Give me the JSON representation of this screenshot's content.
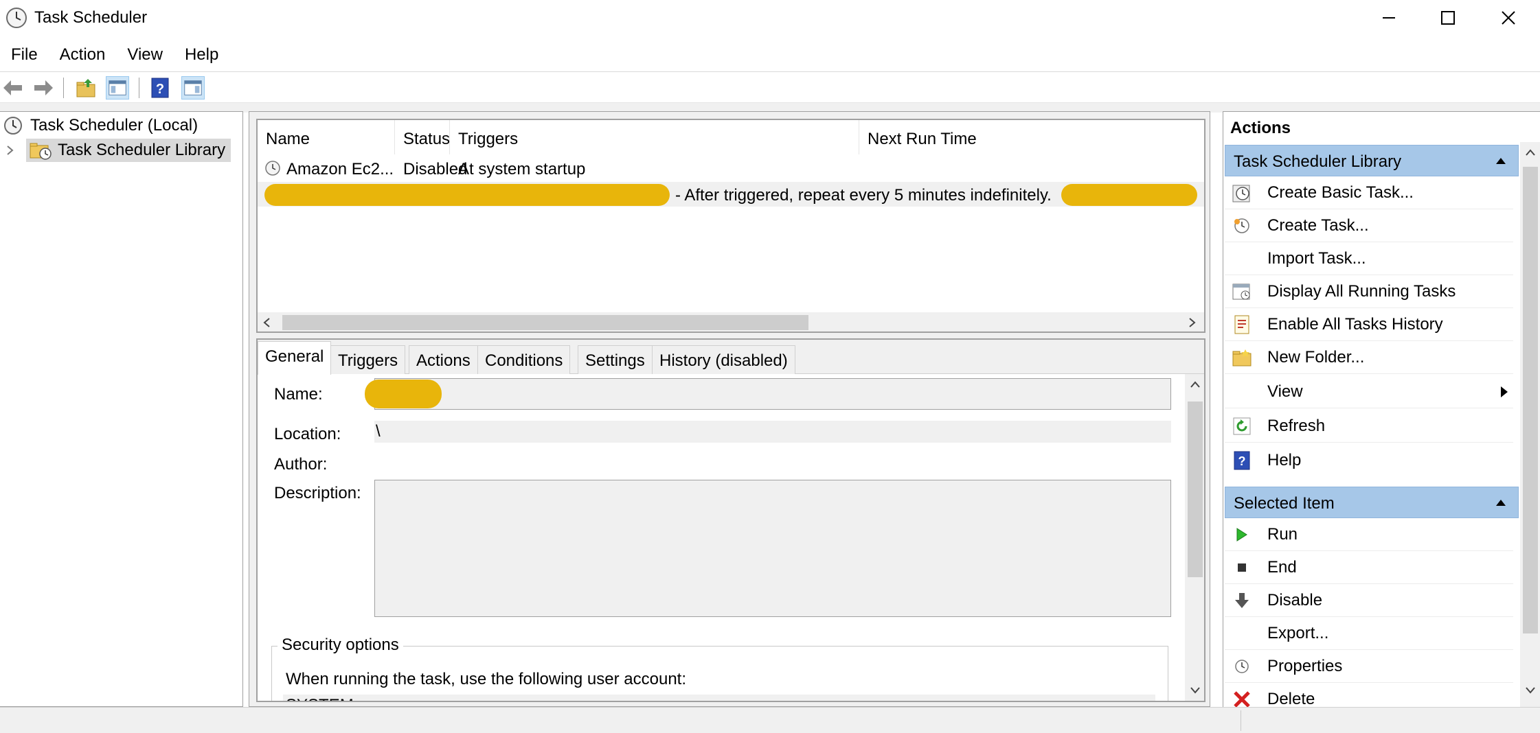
{
  "window": {
    "title": "Task Scheduler"
  },
  "menu": {
    "items": [
      "File",
      "Action",
      "View",
      "Help"
    ]
  },
  "tree": {
    "root": "Task Scheduler (Local)",
    "library": "Task Scheduler Library"
  },
  "tasklist": {
    "columns": [
      "Name",
      "Status",
      "Triggers",
      "Next Run Time"
    ],
    "rows": [
      {
        "name": "Amazon Ec2...",
        "status": "Disabled",
        "triggers": "At system startup"
      },
      {
        "name": "",
        "status": "",
        "triggers": "- After triggered, repeat every 5 minutes indefinitely."
      }
    ]
  },
  "detail": {
    "tabs": [
      "General",
      "Triggers",
      "Actions",
      "Conditions",
      "Settings",
      "History (disabled)"
    ],
    "active_tab": "General",
    "labels": {
      "name": "Name:",
      "location": "Location:",
      "author": "Author:",
      "description": "Description:"
    },
    "values": {
      "location": "\\"
    },
    "security": {
      "group_label": "Security options",
      "account_text": "When running the task, use the following user account:",
      "account_value": "SYSTEM"
    }
  },
  "actions": {
    "title": "Actions",
    "sections": [
      {
        "header": "Task Scheduler Library",
        "items": [
          {
            "label": "Create Basic Task...",
            "icon": "clock-wizard-icon"
          },
          {
            "label": "Create Task...",
            "icon": "clock-create-icon"
          },
          {
            "label": "Import Task...",
            "icon": ""
          },
          {
            "label": "Display All Running Tasks",
            "icon": "running-tasks-icon"
          },
          {
            "label": "Enable All Tasks History",
            "icon": "history-icon"
          },
          {
            "label": "New Folder...",
            "icon": "folder-icon"
          },
          {
            "label": "View",
            "icon": "",
            "submenu": true
          },
          {
            "label": "Refresh",
            "icon": "refresh-icon"
          },
          {
            "label": "Help",
            "icon": "help-icon"
          }
        ]
      },
      {
        "header": "Selected Item",
        "items": [
          {
            "label": "Run",
            "icon": "run-icon"
          },
          {
            "label": "End",
            "icon": "end-icon"
          },
          {
            "label": "Disable",
            "icon": "disable-icon"
          },
          {
            "label": "Export...",
            "icon": ""
          },
          {
            "label": "Properties",
            "icon": "properties-icon"
          },
          {
            "label": "Delete",
            "icon": "delete-icon"
          }
        ]
      }
    ]
  },
  "colors": {
    "accent_header": "#a6c7e8",
    "redaction": "#e8b50b"
  }
}
